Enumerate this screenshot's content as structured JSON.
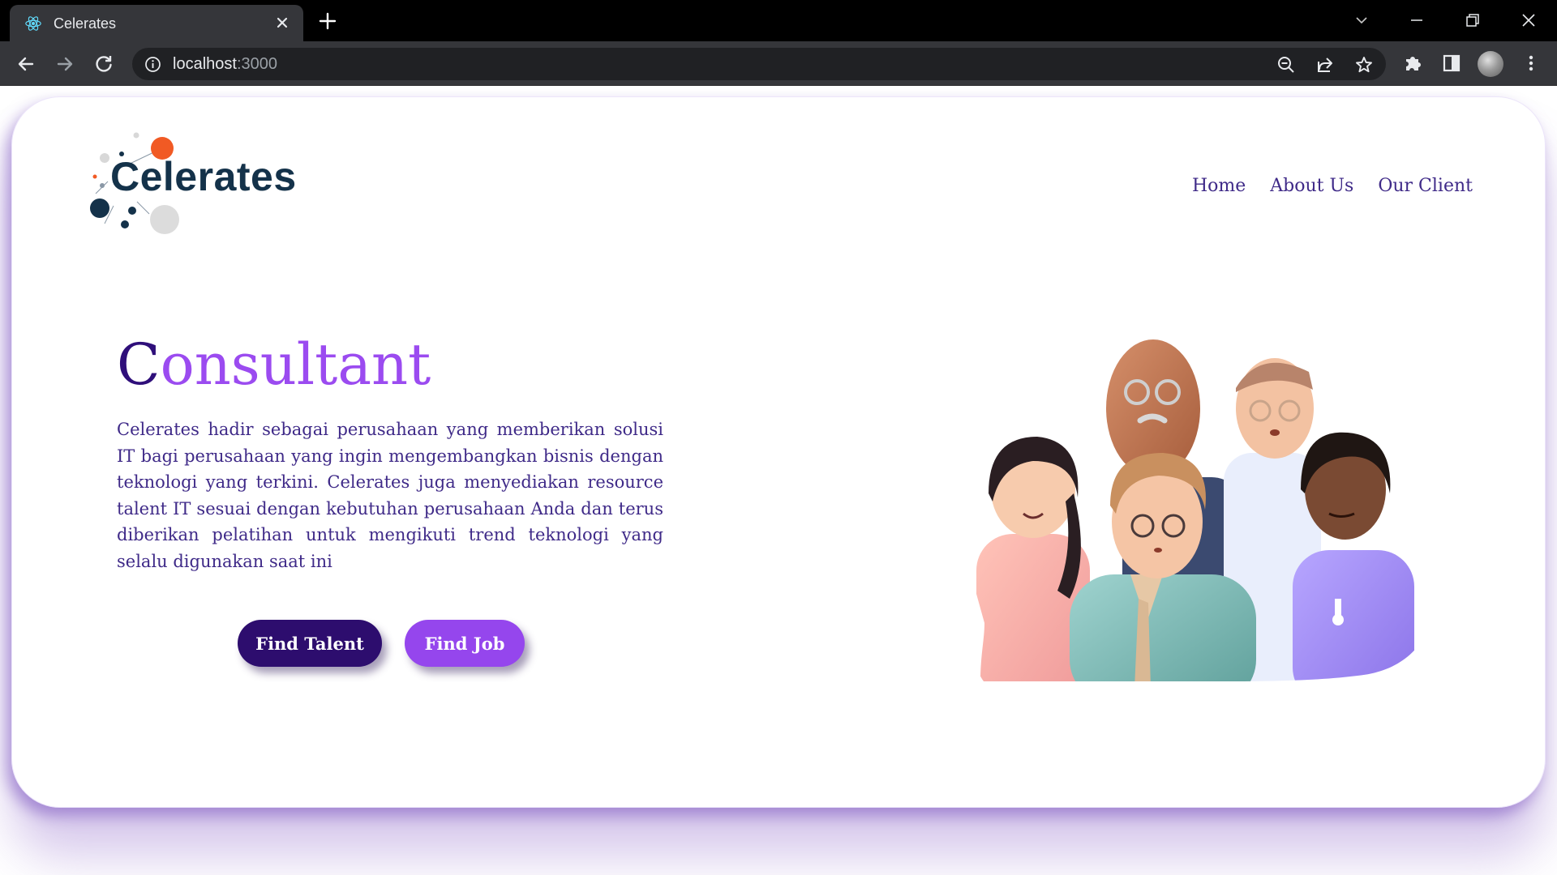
{
  "browser": {
    "tab_title": "Celerates",
    "url_host": "localhost",
    "url_port": ":3000",
    "icons": [
      "react-favicon-icon",
      "close-icon",
      "plus-icon",
      "chevron-down-icon",
      "minimize-icon",
      "restore-icon",
      "close-window-icon",
      "back-icon",
      "forward-icon",
      "reload-icon",
      "info-icon",
      "zoom-out-icon",
      "share-icon",
      "star-icon",
      "puzzle-icon",
      "side-panel-icon",
      "profile-avatar",
      "more-vert-icon"
    ]
  },
  "header": {
    "logo_text": "Celerates",
    "nav": [
      "Home",
      "About Us",
      "Our Client"
    ]
  },
  "hero": {
    "title_first": "C",
    "title_rest": "onsultant",
    "description": "Celerates hadir sebagai perusahaan yang memberikan solusi IT bagi perusahaan yang ingin mengembangkan bisnis dengan teknologi yang terkini. Celerates juga menyediakan resource talent IT sesuai dengan kebutuhan perusahaan Anda dan terus diberikan pelatihan untuk mengikuti trend teknologi yang selalu digunakan saat ini",
    "buttons": {
      "find_talent": "Find Talent",
      "find_job": "Find Job"
    }
  },
  "colors": {
    "primary_dark": "#2d0d6e",
    "primary_light": "#9546ed",
    "text": "#3f2a88",
    "logo_navy": "#14324a",
    "logo_orange": "#f15a24"
  }
}
